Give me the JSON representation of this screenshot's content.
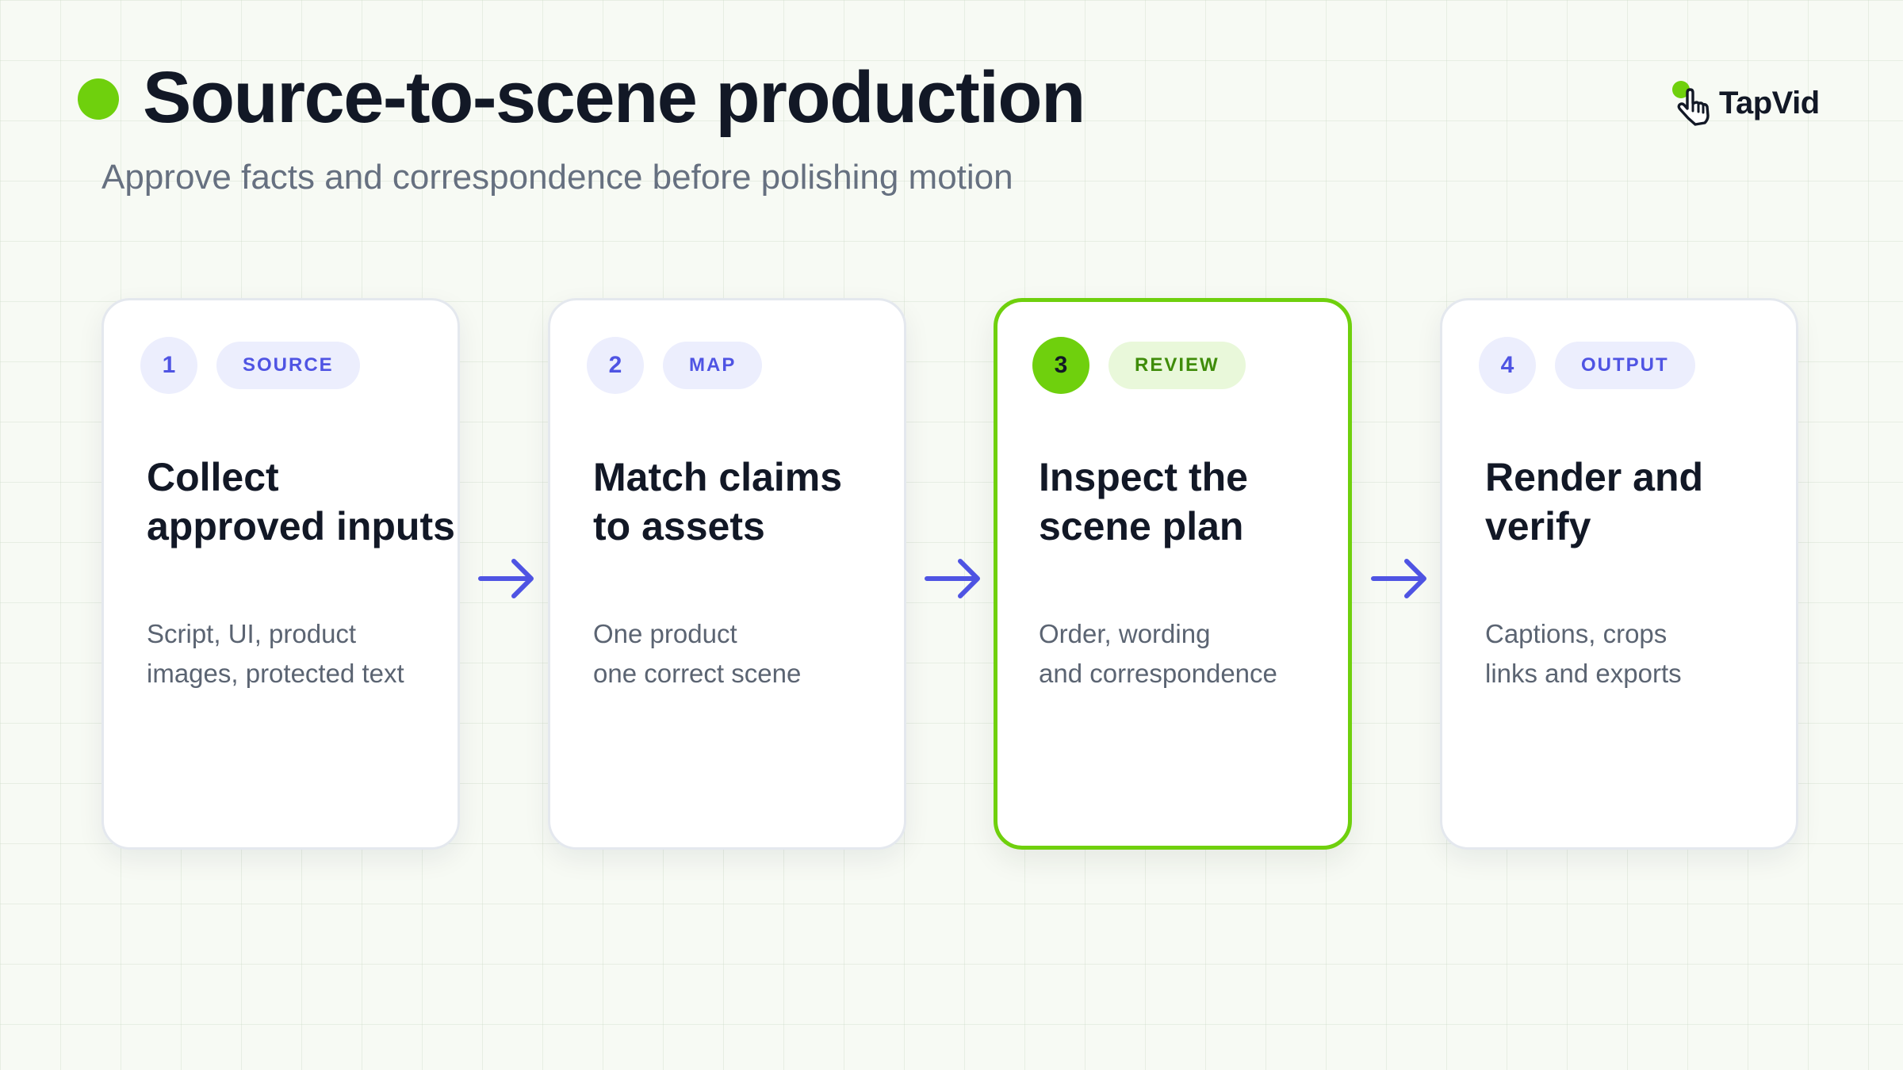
{
  "header": {
    "title": "Source-to-scene production",
    "subtitle": "Approve facts and correspondence before polishing motion"
  },
  "brand": {
    "logo_text": "TapVid",
    "logo_icon": "pointer-hand-icon"
  },
  "steps": [
    {
      "number": "1",
      "tag": "SOURCE",
      "title": [
        "Collect",
        "approved inputs"
      ],
      "description": [
        "Script, UI, product",
        "images, protected text"
      ],
      "active": false
    },
    {
      "number": "2",
      "tag": "MAP",
      "title": [
        "Match claims",
        "to assets"
      ],
      "description": [
        "One product",
        "one correct scene"
      ],
      "active": false
    },
    {
      "number": "3",
      "tag": "REVIEW",
      "title": [
        "Inspect the",
        "scene plan"
      ],
      "description": [
        "Order, wording",
        "and correspondence"
      ],
      "active": true
    },
    {
      "number": "4",
      "tag": "OUTPUT",
      "title": [
        "Render and",
        "verify"
      ],
      "description": [
        "Captions, crops",
        "links and exports"
      ],
      "active": false
    }
  ],
  "connector_icon": "arrow-right-icon",
  "colors": {
    "title_text": "#121826",
    "subtitle_text": "#667080",
    "body_text": "#5b6472",
    "accent_blue": "#4f54e3",
    "blue_tint": "#eceefd",
    "accent_green": "#6fd00d",
    "green_tint": "#e9f8da",
    "green_dark": "#3f8c0a",
    "card_border": "#e4e8ee"
  }
}
